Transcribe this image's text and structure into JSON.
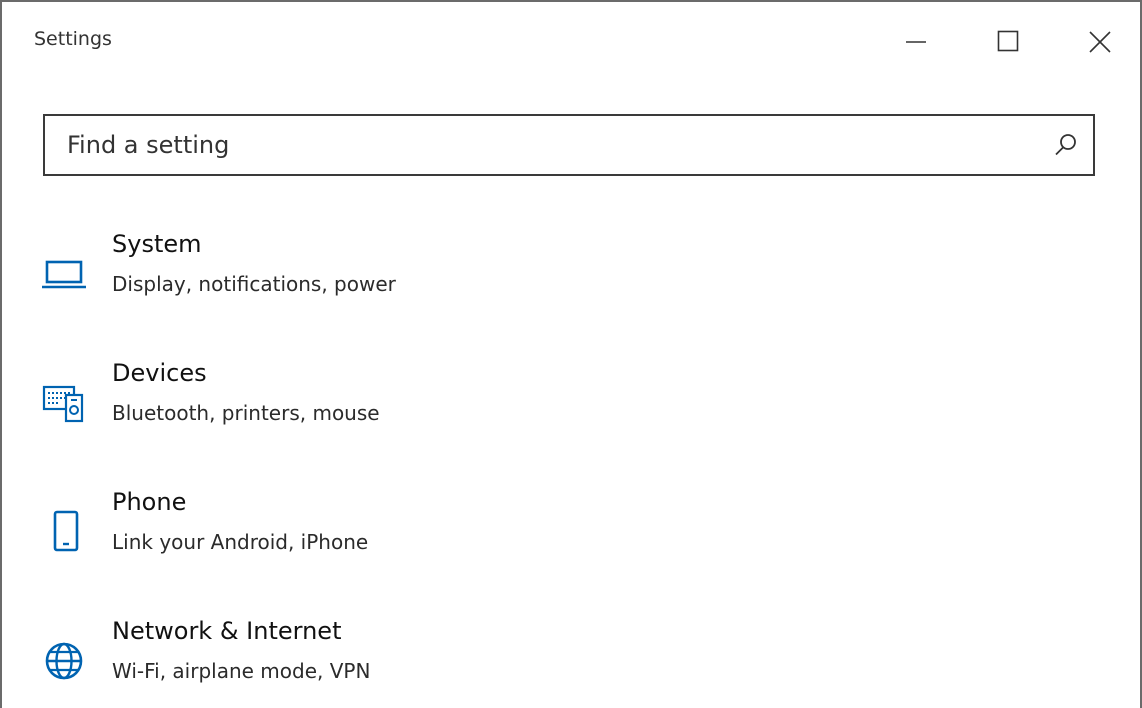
{
  "window": {
    "title": "Settings"
  },
  "controls": {
    "minimize_icon": "minimize-icon",
    "maximize_icon": "maximize-icon",
    "close_icon": "close-icon"
  },
  "search": {
    "placeholder": "Find a setting",
    "icon": "search-icon"
  },
  "categories": [
    {
      "title": "System",
      "subtitle": "Display, notifications, power",
      "icon": "laptop-icon"
    },
    {
      "title": "Devices",
      "subtitle": "Bluetooth, printers, mouse",
      "icon": "devices-icon"
    },
    {
      "title": "Phone",
      "subtitle": "Link your Android, iPhone",
      "icon": "phone-icon"
    },
    {
      "title": "Network & Internet",
      "subtitle": "Wi-Fi, airplane mode, VPN",
      "icon": "globe-icon"
    }
  ],
  "colors": {
    "accent": "#0063b1",
    "text": "#111111",
    "border": "#3a3a3a"
  }
}
